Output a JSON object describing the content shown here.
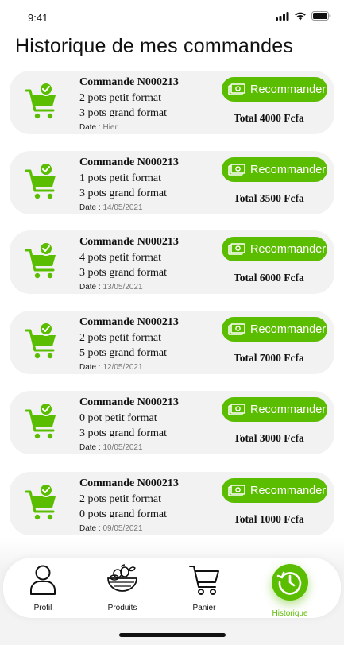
{
  "status_bar": {
    "time": "9:41"
  },
  "page": {
    "title": "Historique de mes commandes"
  },
  "orders": [
    {
      "title": "Commande N000213",
      "line1": "2 pots petit format",
      "line2": "3 pots grand format",
      "date_label": "Date : ",
      "date": "Hier",
      "button_label": "Recommander",
      "total": "Total 4000 Fcfa"
    },
    {
      "title": "Commande N000213",
      "line1": "1 pots petit format",
      "line2": "3 pots grand format",
      "date_label": "Date : ",
      "date": "14/05/2021",
      "button_label": "Recommander",
      "total": "Total 3500 Fcfa"
    },
    {
      "title": "Commande N000213",
      "line1": "4 pots petit format",
      "line2": "3 pots grand format",
      "date_label": "Date : ",
      "date": "13/05/2021",
      "button_label": "Recommander",
      "total": "Total 6000 Fcfa"
    },
    {
      "title": "Commande N000213",
      "line1": "2 pots petit format",
      "line2": "5 pots grand format",
      "date_label": "Date : ",
      "date": "12/05/2021",
      "button_label": "Recommander",
      "total": "Total 7000 Fcfa"
    },
    {
      "title": "Commande N000213",
      "line1": "0 pot petit format",
      "line2": "3 pots grand format",
      "date_label": "Date : ",
      "date": "10/05/2021",
      "button_label": "Recommander",
      "total": "Total 3000 Fcfa"
    },
    {
      "title": "Commande N000213",
      "line1": "2 pots petit format",
      "line2": "0 pots grand format",
      "date_label": "Date : ",
      "date": "09/05/2021",
      "button_label": "Recommander",
      "total": "Total 1000 Fcfa"
    }
  ],
  "nav": {
    "items": [
      {
        "label": "Profil",
        "icon": "user-icon",
        "active": false
      },
      {
        "label": "Produits",
        "icon": "basket-icon",
        "active": false
      },
      {
        "label": "Panier",
        "icon": "cart-icon",
        "active": false
      },
      {
        "label": "Historique",
        "icon": "history-icon",
        "active": true
      }
    ]
  },
  "colors": {
    "accent": "#5bbd00",
    "card_bg": "#f2f2f2",
    "date_muted": "#777777"
  }
}
